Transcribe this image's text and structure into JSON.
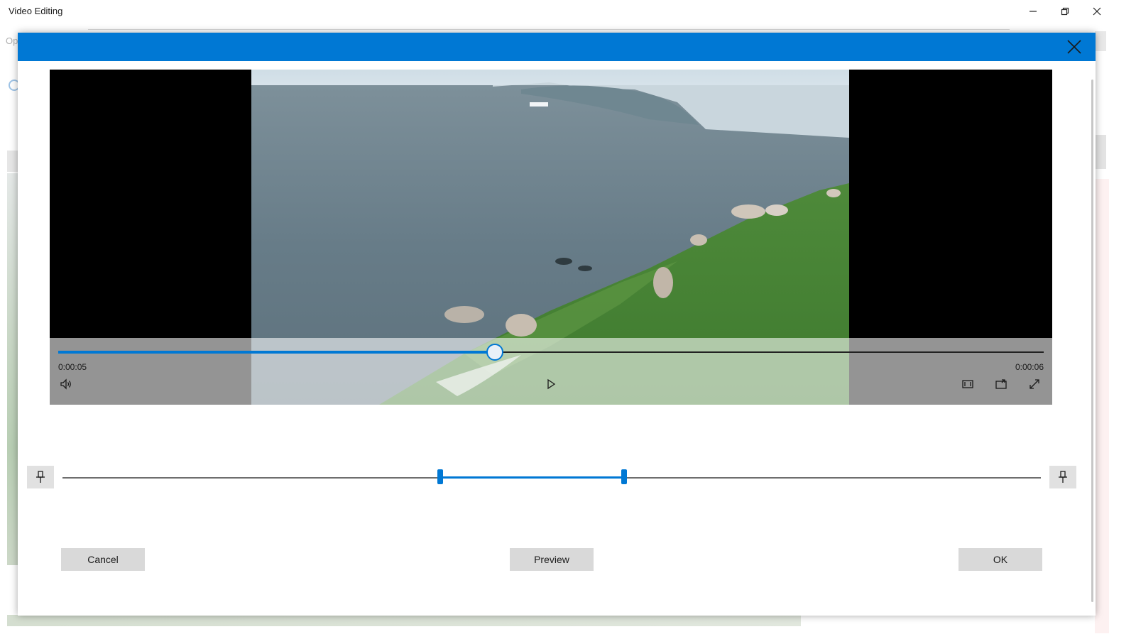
{
  "window": {
    "title": "Video Editing",
    "background_hint_text": "Op"
  },
  "player": {
    "current_time": "0:00:05",
    "total_time": "0:00:06",
    "seek_progress": 0.443
  },
  "trim": {
    "start_fraction": 0.386,
    "end_fraction": 0.574
  },
  "buttons": {
    "cancel": "Cancel",
    "preview": "Preview",
    "ok": "OK"
  },
  "colors": {
    "accent": "#0078d4",
    "button_bg": "#d9d9d9"
  },
  "icons": {
    "minimize": "minimize-icon",
    "restore": "restore-icon",
    "close": "close-icon",
    "volume": "volume-icon",
    "play": "play-icon",
    "aspect": "aspect-ratio-icon",
    "cast": "cast-icon",
    "fullscreen": "fullscreen-icon",
    "pin": "pin-icon"
  }
}
